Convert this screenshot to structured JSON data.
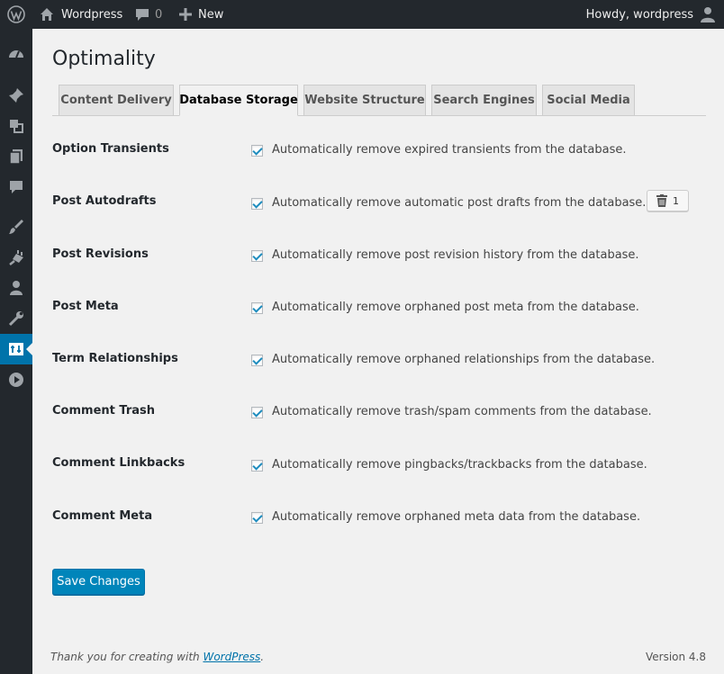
{
  "admin_bar": {
    "site_name": "Wordpress",
    "comments_count": "0",
    "new_label": "New",
    "howdy": "Howdy, wordpress",
    "icons": [
      "wordpress-logo-icon",
      "home-icon",
      "comment-bubble-icon",
      "plus-icon",
      "user-avatar-icon"
    ]
  },
  "side_menu": {
    "icons": [
      "dashboard-icon",
      "pin-posts-icon",
      "media-icon",
      "pages-icon",
      "comments-icon",
      "appearance-brush-icon",
      "plugins-icon",
      "users-icon",
      "tools-wrench-icon",
      "settings-icon",
      "play-icon"
    ],
    "active_index": 9,
    "active_color": "#0073aa"
  },
  "page": {
    "title": "Optimality"
  },
  "tabs": [
    {
      "label": "Content Delivery",
      "active": false
    },
    {
      "label": "Database Storage",
      "active": true
    },
    {
      "label": "Website Structure",
      "active": false
    },
    {
      "label": "Search Engines",
      "active": false
    },
    {
      "label": "Social Media",
      "active": false
    }
  ],
  "settings": [
    {
      "label": "Option Transients",
      "description": "Automatically remove expired transients from the database.",
      "checked": true
    },
    {
      "label": "Post Autodrafts",
      "description": "Automatically remove automatic post drafts from the database.",
      "checked": true
    },
    {
      "label": "Post Revisions",
      "description": "Automatically remove post revision history from the database.",
      "checked": true
    },
    {
      "label": "Post Meta",
      "description": "Automatically remove orphaned post meta from the database.",
      "checked": true
    },
    {
      "label": "Term Relationships",
      "description": "Automatically remove orphaned relationships from the database.",
      "checked": true
    },
    {
      "label": "Comment Trash",
      "description": "Automatically remove trash/spam comments from the database.",
      "checked": true
    },
    {
      "label": "Comment Linkbacks",
      "description": "Automatically remove pingbacks/trackbacks from the database.",
      "checked": true
    },
    {
      "label": "Comment Meta",
      "description": "Automatically remove orphaned meta data from the database.",
      "checked": true
    }
  ],
  "autodraft_cleanup": {
    "icon": "trash-icon",
    "count": "1"
  },
  "save_button": "Save Changes",
  "footer": {
    "thanks_prefix": "Thank you for creating with ",
    "thanks_link": "WordPress",
    "thanks_suffix": ".",
    "version": "Version 4.8"
  },
  "colors": {
    "admin_bar": "#23282d",
    "primary_button": "#0085ba",
    "checkmark": "#1e8cbe",
    "background": "#f1f1f1"
  }
}
